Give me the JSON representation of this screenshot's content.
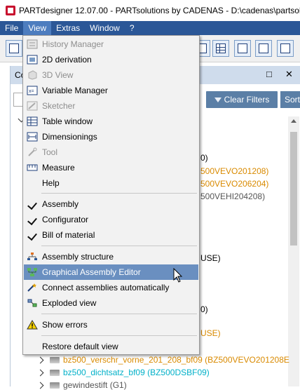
{
  "window": {
    "title": "PARTdesigner 12.07.00 - PARTsolutions by CADENAS - D:\\cadenas\\partsolutio"
  },
  "menubar": {
    "items": [
      "File",
      "View",
      "Extras",
      "Window",
      "?"
    ]
  },
  "panel": {
    "tab_label": "Co",
    "pin_glyph": "□",
    "close_glyph": "✕",
    "clear_filters_label": "Clear Filters",
    "sort_label": "Sort"
  },
  "background_fragments": [
    {
      "text": "0)",
      "color": "#000000"
    },
    {
      "text": "500VEVO201208)",
      "color": "#d98a00"
    },
    {
      "text": "500VEVO206204)",
      "color": "#d98a00"
    },
    {
      "text": "500VEHI204208)",
      "color": "#555555"
    },
    {
      "text": "USE)",
      "color": "#000000"
    },
    {
      "text": "0)",
      "color": "#000000"
    },
    {
      "text": "USE)",
      "color": "#d98a00"
    }
  ],
  "tree_rows": [
    {
      "label": "bz500_verschr_vorne_201_208_bf09 (BZ500VEVO201208E",
      "color": "#d98a00"
    },
    {
      "label": "bz500_dichtsatz_bf09 (BZ500DSBF09)",
      "color": "#00b0c8"
    },
    {
      "label": "gewindestift (G1)",
      "color": "#555555"
    }
  ],
  "view_menu": {
    "items": [
      {
        "label": "History Manager",
        "icon": "history-icon",
        "disabled": true
      },
      {
        "label": "2D derivation",
        "icon": "derivation-icon",
        "disabled": false
      },
      {
        "label": "3D View",
        "icon": "3d-view-icon",
        "disabled": true
      },
      {
        "label": "Variable Manager",
        "icon": "variable-icon",
        "disabled": false
      },
      {
        "label": "Sketcher",
        "icon": "sketcher-icon",
        "disabled": true
      },
      {
        "label": "Table window",
        "icon": "table-icon",
        "disabled": false
      },
      {
        "label": "Dimensionings",
        "icon": "dimension-icon",
        "disabled": false
      },
      {
        "label": "Tool",
        "icon": "tool-icon",
        "disabled": true
      },
      {
        "label": "Measure",
        "icon": "measure-icon",
        "disabled": false
      },
      {
        "label": "Help",
        "icon": "",
        "disabled": false
      },
      {
        "label": "Assembly",
        "icon": "checkmark-icon",
        "disabled": false,
        "checked": true
      },
      {
        "label": "Configurator",
        "icon": "checkmark-icon",
        "disabled": false,
        "checked": true
      },
      {
        "label": "Bill of material",
        "icon": "checkmark-icon",
        "disabled": false,
        "checked": true
      },
      {
        "label": "Assembly structure",
        "icon": "assembly-structure-icon",
        "disabled": false
      },
      {
        "label": "Graphical Assembly Editor",
        "icon": "graphical-editor-icon",
        "disabled": false,
        "highlighted": true
      },
      {
        "label": "Connect assemblies automatically",
        "icon": "connect-icon",
        "disabled": false
      },
      {
        "label": "Exploded view",
        "icon": "exploded-view-icon",
        "disabled": false
      },
      {
        "label": "Show errors",
        "icon": "warning-icon",
        "disabled": false
      },
      {
        "label": "Restore default view",
        "icon": "",
        "disabled": false
      }
    ]
  }
}
